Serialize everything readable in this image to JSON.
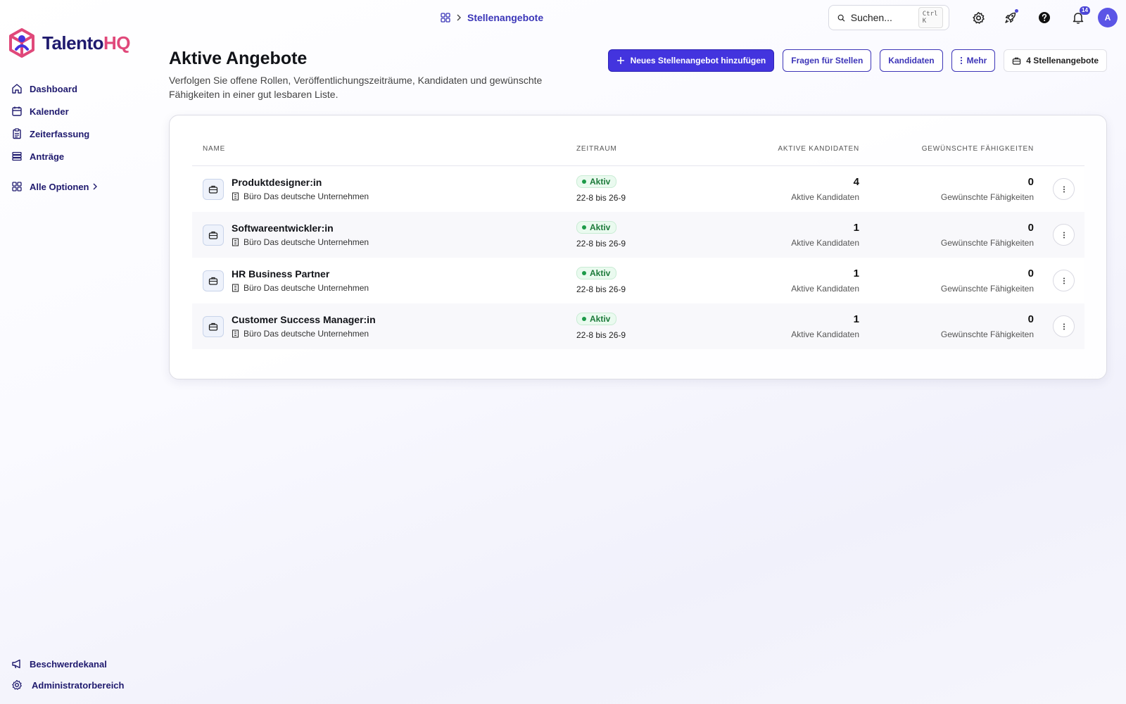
{
  "brand": {
    "name_main": "Talento",
    "name_accent": "HQ",
    "accent_color": "#e0487a",
    "primary_color": "#4334de"
  },
  "sidebar": {
    "items": [
      {
        "label": "Dashboard",
        "icon": "home-icon"
      },
      {
        "label": "Kalender",
        "icon": "calendar-icon"
      },
      {
        "label": "Zeiterfassung",
        "icon": "clipboard-icon"
      },
      {
        "label": "Anträge",
        "icon": "stack-icon"
      }
    ],
    "all_options": {
      "label": "Alle Optionen",
      "icon": "grid-icon"
    },
    "bottom": [
      {
        "label": "Beschwerdekanal",
        "icon": "megaphone-icon"
      },
      {
        "label": "Administratorbereich",
        "icon": "gear-icon"
      }
    ]
  },
  "topbar": {
    "breadcrumb": "Stellenangebote",
    "search_placeholder": "Suchen...",
    "search_shortcut": "Ctrl K",
    "notifications_count": "14",
    "avatar_initial": "A"
  },
  "header": {
    "title": "Aktive Angebote",
    "subtitle": "Verfolgen Sie offene Rollen, Veröffentlichungszeiträume, Kandidaten und gewünschte Fähigkeiten in einer gut lesbaren Liste.",
    "actions": {
      "add": "Neues Stellenangebot hinzufügen",
      "questions": "Fragen für Stellen",
      "candidates": "Kandidaten",
      "more": "Mehr",
      "count": "4 Stellenangebote"
    }
  },
  "table": {
    "columns": {
      "name": "Name",
      "period": "Zeitraum",
      "candidates": "Aktive Kandidaten",
      "skills": "Gewünschte Fähigkeiten"
    },
    "rows": [
      {
        "title": "Produktdesigner:in",
        "office": "Büro Das deutsche Unternehmen",
        "status": "Aktiv",
        "period": "22-8 bis 26-9",
        "candidates": "4",
        "candidates_label": "Aktive Kandidaten",
        "skills": "0",
        "skills_label": "Gewünschte Fähigkeiten"
      },
      {
        "title": "Softwareentwickler:in",
        "office": "Büro Das deutsche Unternehmen",
        "status": "Aktiv",
        "period": "22-8 bis 26-9",
        "candidates": "1",
        "candidates_label": "Aktive Kandidaten",
        "skills": "0",
        "skills_label": "Gewünschte Fähigkeiten"
      },
      {
        "title": "HR Business Partner",
        "office": "Büro Das deutsche Unternehmen",
        "status": "Aktiv",
        "period": "22-8 bis 26-9",
        "candidates": "1",
        "candidates_label": "Aktive Kandidaten",
        "skills": "0",
        "skills_label": "Gewünschte Fähigkeiten"
      },
      {
        "title": "Customer Success Manager:in",
        "office": "Büro Das deutsche Unternehmen",
        "status": "Aktiv",
        "period": "22-8 bis 26-9",
        "candidates": "1",
        "candidates_label": "Aktive Kandidaten",
        "skills": "0",
        "skills_label": "Gewünschte Fähigkeiten"
      }
    ]
  }
}
